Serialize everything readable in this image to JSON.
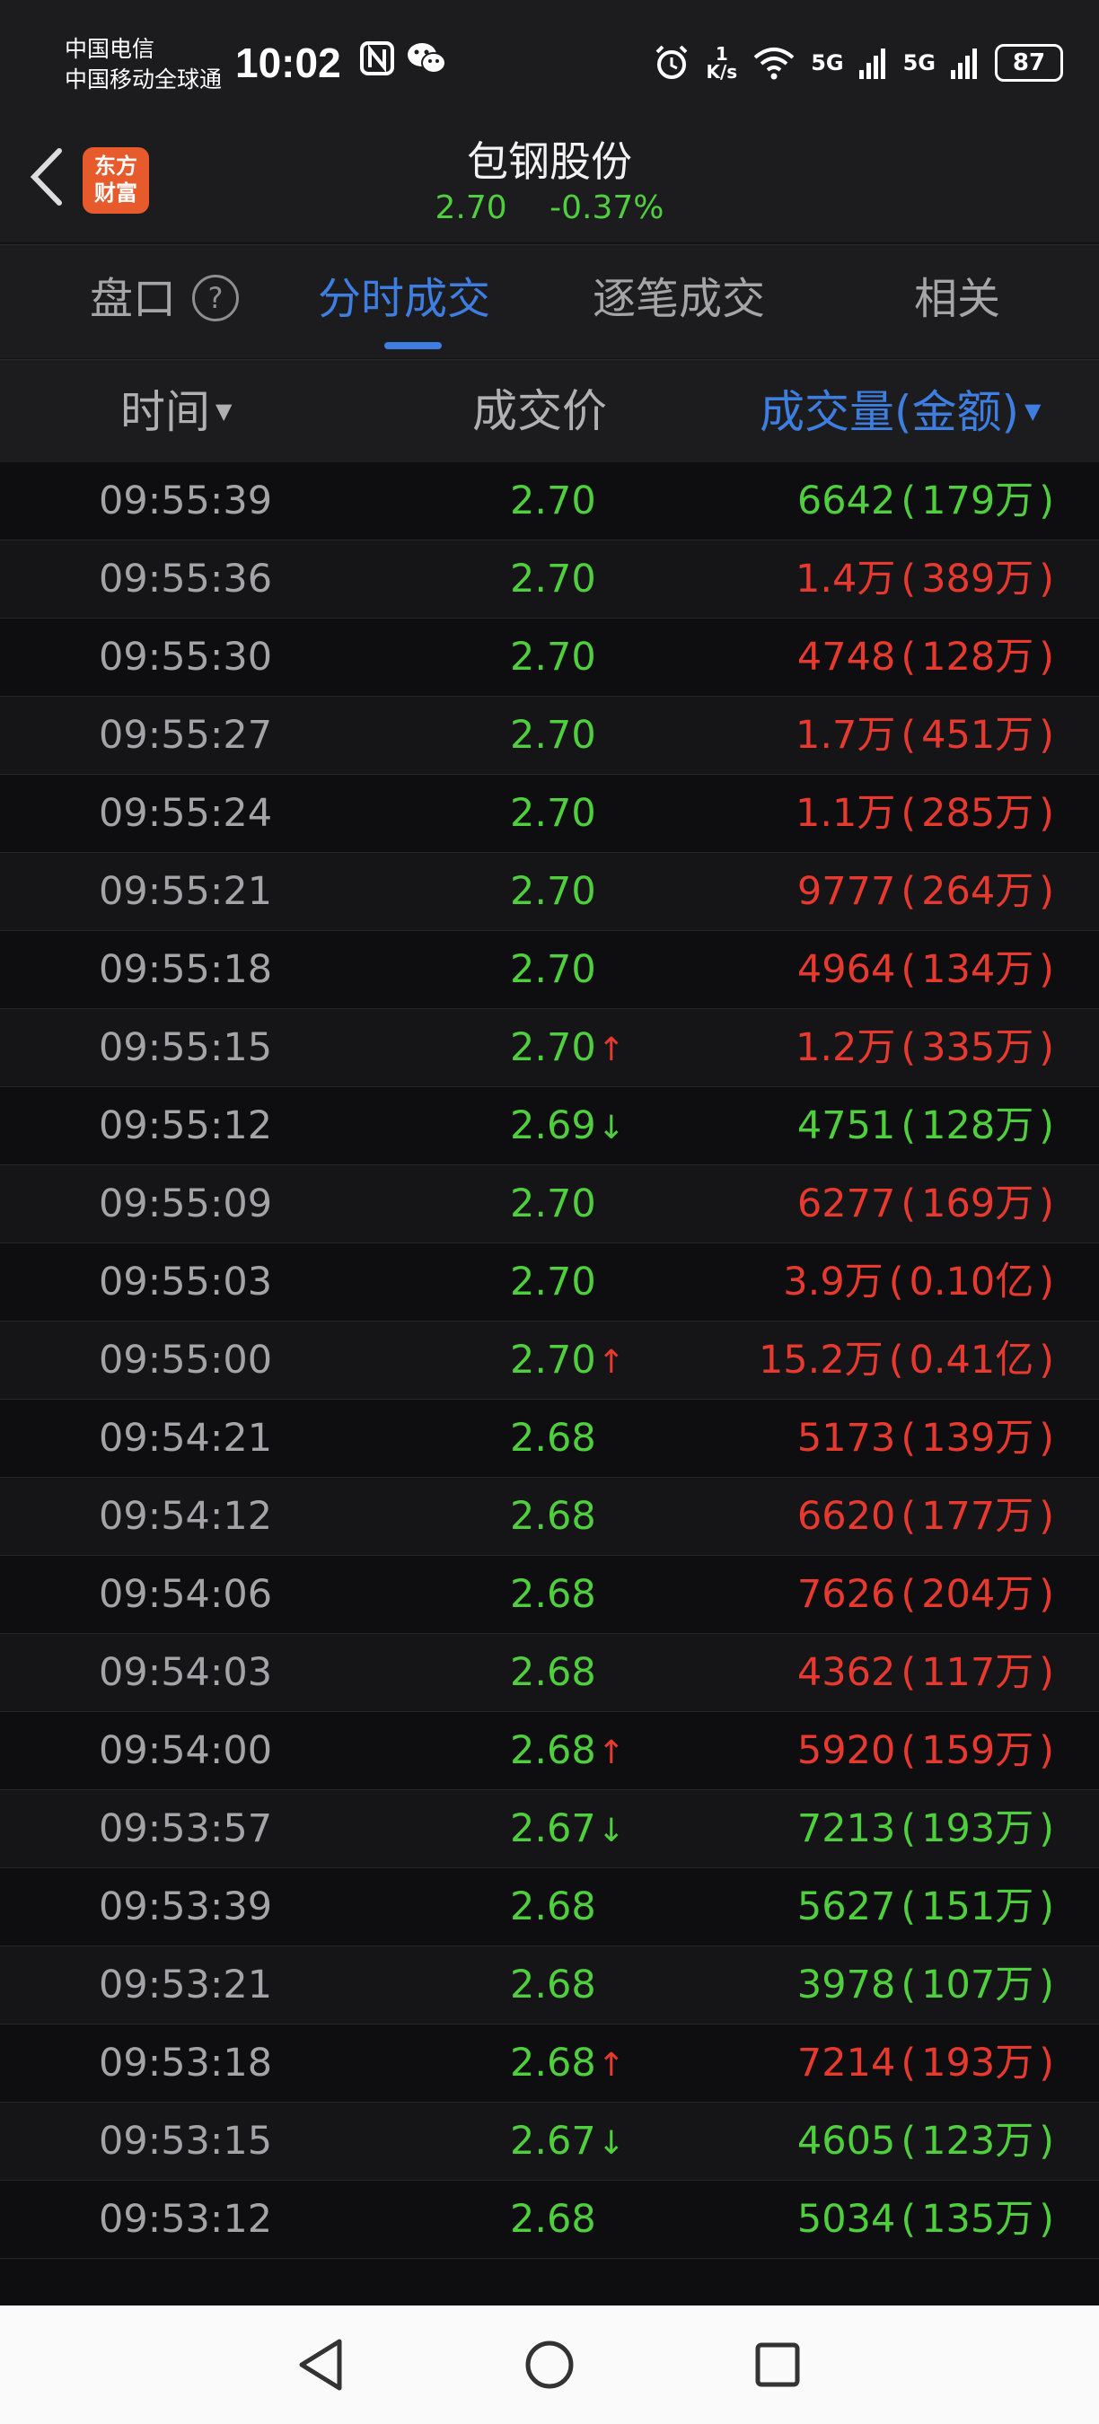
{
  "status": {
    "carrier_line1": "中国电信",
    "carrier_line2": "中国移动全球通",
    "time": "10:02",
    "net_speed_value": "1",
    "net_speed_unit": "K/s",
    "signal1": "5G",
    "signal2": "5G",
    "battery": "87"
  },
  "header": {
    "back_icon": "chevron-left-icon",
    "logo_line1": "东方",
    "logo_line2": "财富",
    "stock_name": "包钢股份",
    "price": "2.70",
    "change_pct": "-0.37%"
  },
  "tabs": [
    {
      "label": "盘口",
      "active": false
    },
    {
      "label": "分时成交",
      "active": true
    },
    {
      "label": "逐笔成交",
      "active": false
    },
    {
      "label": "相关",
      "active": false
    }
  ],
  "help_icon": "?",
  "columns": {
    "time": "时间",
    "price": "成交价",
    "volume": "成交量(金额)"
  },
  "trades": [
    {
      "time": "09:55:39",
      "price": "2.70",
      "price_color": "green",
      "arrow": "",
      "volume": "6642",
      "amount": "179万",
      "vol_color": "green"
    },
    {
      "time": "09:55:36",
      "price": "2.70",
      "price_color": "green",
      "arrow": "",
      "volume": "1.4万",
      "amount": "389万",
      "vol_color": "red"
    },
    {
      "time": "09:55:30",
      "price": "2.70",
      "price_color": "green",
      "arrow": "",
      "volume": "4748",
      "amount": "128万",
      "vol_color": "red"
    },
    {
      "time": "09:55:27",
      "price": "2.70",
      "price_color": "green",
      "arrow": "",
      "volume": "1.7万",
      "amount": "451万",
      "vol_color": "red"
    },
    {
      "time": "09:55:24",
      "price": "2.70",
      "price_color": "green",
      "arrow": "",
      "volume": "1.1万",
      "amount": "285万",
      "vol_color": "red"
    },
    {
      "time": "09:55:21",
      "price": "2.70",
      "price_color": "green",
      "arrow": "",
      "volume": "9777",
      "amount": "264万",
      "vol_color": "red"
    },
    {
      "time": "09:55:18",
      "price": "2.70",
      "price_color": "green",
      "arrow": "",
      "volume": "4964",
      "amount": "134万",
      "vol_color": "red"
    },
    {
      "time": "09:55:15",
      "price": "2.70",
      "price_color": "green",
      "arrow": "↑",
      "volume": "1.2万",
      "amount": "335万",
      "vol_color": "red"
    },
    {
      "time": "09:55:12",
      "price": "2.69",
      "price_color": "green",
      "arrow": "↓",
      "volume": "4751",
      "amount": "128万",
      "vol_color": "green"
    },
    {
      "time": "09:55:09",
      "price": "2.70",
      "price_color": "green",
      "arrow": "",
      "volume": "6277",
      "amount": "169万",
      "vol_color": "red"
    },
    {
      "time": "09:55:03",
      "price": "2.70",
      "price_color": "green",
      "arrow": "",
      "volume": "3.9万",
      "amount": "0.10亿",
      "vol_color": "red"
    },
    {
      "time": "09:55:00",
      "price": "2.70",
      "price_color": "green",
      "arrow": "↑",
      "volume": "15.2万",
      "amount": "0.41亿",
      "vol_color": "red"
    },
    {
      "time": "09:54:21",
      "price": "2.68",
      "price_color": "green",
      "arrow": "",
      "volume": "5173",
      "amount": "139万",
      "vol_color": "red"
    },
    {
      "time": "09:54:12",
      "price": "2.68",
      "price_color": "green",
      "arrow": "",
      "volume": "6620",
      "amount": "177万",
      "vol_color": "red"
    },
    {
      "time": "09:54:06",
      "price": "2.68",
      "price_color": "green",
      "arrow": "",
      "volume": "7626",
      "amount": "204万",
      "vol_color": "red"
    },
    {
      "time": "09:54:03",
      "price": "2.68",
      "price_color": "green",
      "arrow": "",
      "volume": "4362",
      "amount": "117万",
      "vol_color": "red"
    },
    {
      "time": "09:54:00",
      "price": "2.68",
      "price_color": "green",
      "arrow": "↑",
      "volume": "5920",
      "amount": "159万",
      "vol_color": "red"
    },
    {
      "time": "09:53:57",
      "price": "2.67",
      "price_color": "green",
      "arrow": "↓",
      "volume": "7213",
      "amount": "193万",
      "vol_color": "green"
    },
    {
      "time": "09:53:39",
      "price": "2.68",
      "price_color": "green",
      "arrow": "",
      "volume": "5627",
      "amount": "151万",
      "vol_color": "green"
    },
    {
      "time": "09:53:21",
      "price": "2.68",
      "price_color": "green",
      "arrow": "",
      "volume": "3978",
      "amount": "107万",
      "vol_color": "green"
    },
    {
      "time": "09:53:18",
      "price": "2.68",
      "price_color": "green",
      "arrow": "↑",
      "volume": "7214",
      "amount": "193万",
      "vol_color": "red"
    },
    {
      "time": "09:53:15",
      "price": "2.67",
      "price_color": "green",
      "arrow": "↓",
      "volume": "4605",
      "amount": "123万",
      "vol_color": "green"
    },
    {
      "time": "09:53:12",
      "price": "2.68",
      "price_color": "green",
      "arrow": "",
      "volume": "5034",
      "amount": "135万",
      "vol_color": "green"
    }
  ],
  "colors": {
    "up_red": "#e8392f",
    "down_green": "#4fcf3d",
    "accent_blue": "#3e7ee0",
    "logo_orange": "#e75a2b"
  },
  "nav": {
    "back": "back-triangle-icon",
    "home": "home-circle-icon",
    "recents": "recents-square-icon"
  }
}
